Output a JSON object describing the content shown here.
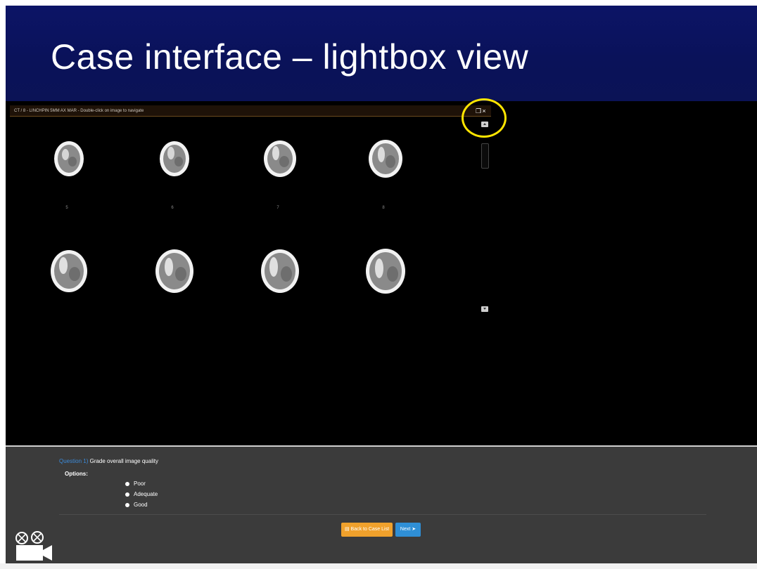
{
  "slide": {
    "title": "Case interface – lightbox view"
  },
  "viewer": {
    "header_text": "CT / 8 - LINCHPIN 5MM AX MAR - Double-click on image to navigate",
    "icons": [
      "restore-icon",
      "close-icon"
    ],
    "close_glyph": "×",
    "restore_glyph": "❐",
    "thumbnails": [
      {
        "label": "5"
      },
      {
        "label": "6"
      },
      {
        "label": "7"
      },
      {
        "label": "8"
      },
      {
        "label": ""
      },
      {
        "label": ""
      },
      {
        "label": ""
      },
      {
        "label": ""
      }
    ],
    "highlight_color": "#ffe500"
  },
  "question": {
    "number": "Question 1)",
    "text": "Grade overall image quality",
    "options_label": "Options:",
    "options": [
      "Poor",
      "Adequate",
      "Good"
    ]
  },
  "buttons": {
    "back": "Back to Case List",
    "next": "Next"
  },
  "colors": {
    "title_band": "#0a1259",
    "panel": "#3b3b3b",
    "back_button": "#f0a12c",
    "next_button": "#2f8fd6",
    "link_blue": "#3c8ad8"
  }
}
